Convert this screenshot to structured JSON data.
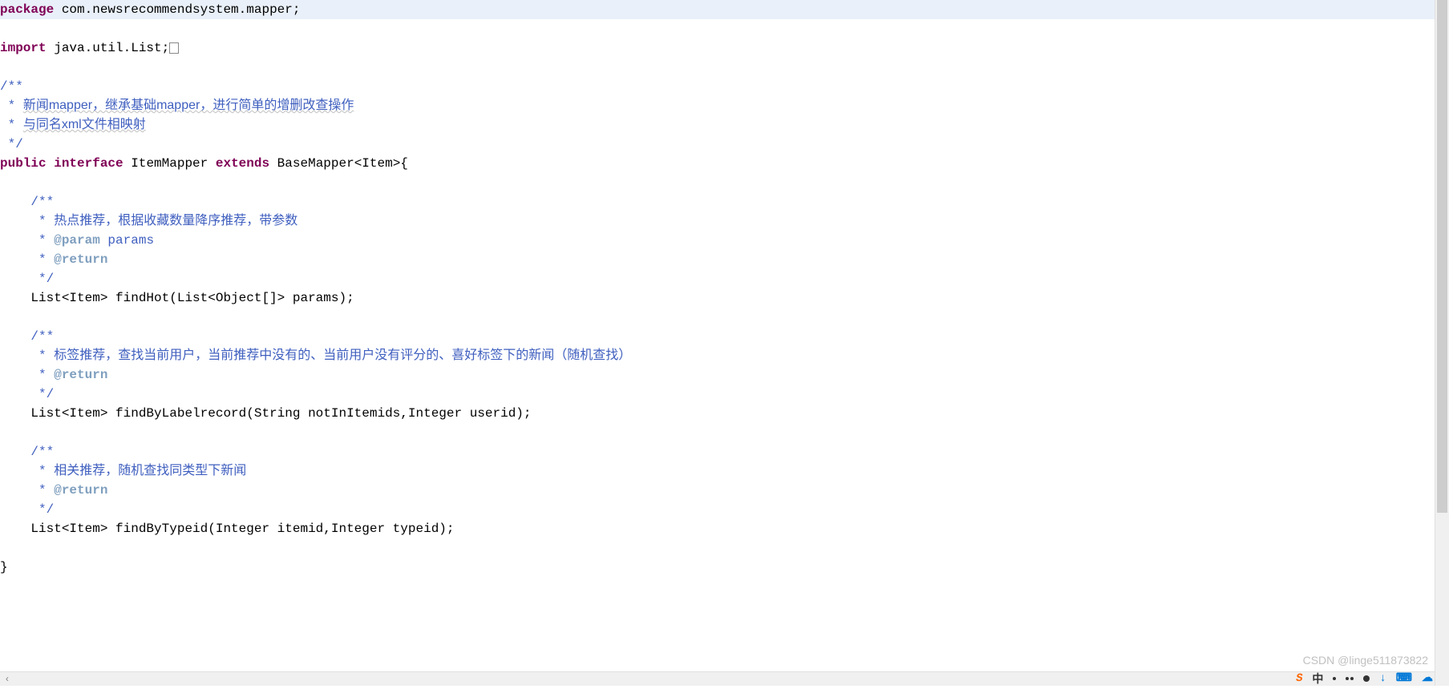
{
  "code": {
    "package_kw": "package",
    "package_name": " com.newsrecommendsystem.mapper;",
    "import_kw": "import",
    "import_name": " java.util.List;",
    "classdoc_open": "/**",
    "classdoc_l1_star": " * ",
    "classdoc_l1_text": "新闻mapper，继承基础mapper，进行简单的增删改查操作",
    "classdoc_l2_star": " * ",
    "classdoc_l2_text": "与同名xml文件相映射",
    "classdoc_close": " */",
    "public_kw": "public",
    "interface_kw": "interface",
    "class_mid": " ItemMapper ",
    "extends_kw": "extends",
    "class_tail": " BaseMapper<Item>{",
    "m1_doc_open": "    /**",
    "m1_doc_l1_star": "     * ",
    "m1_doc_l1_text": "热点推荐，根据收藏数量降序推荐，带参数",
    "m1_doc_l2_star": "     * ",
    "m1_doc_l2_tag": "@param",
    "m1_doc_l2_text": " params",
    "m1_doc_l3_star": "     * ",
    "m1_doc_l3_tag": "@return",
    "m1_doc_close": "     */",
    "m1_sig": "    List<Item> findHot(List<Object[]> params);",
    "m2_doc_open": "    /**",
    "m2_doc_l1_star": "     * ",
    "m2_doc_l1_text": "标签推荐，查找当前用户，当前推荐中没有的、当前用户没有评分的、喜好标签下的新闻（随机查找）",
    "m2_doc_l2_star": "     * ",
    "m2_doc_l2_tag": "@return",
    "m2_doc_close": "     */",
    "m2_sig": "    List<Item> findByLabelrecord(String notInItemids,Integer userid);",
    "m3_doc_open": "    /**",
    "m3_doc_l1_star": "     * ",
    "m3_doc_l1_text": "相关推荐，随机查找同类型下新闻",
    "m3_doc_l2_star": "     * ",
    "m3_doc_l2_tag": "@return",
    "m3_doc_close": "     */",
    "m3_sig": "    List<Item> findByTypeid(Integer itemid,Integer typeid);",
    "class_close": "}"
  },
  "watermark": "CSDN @linge511873822",
  "tray": {
    "s": "S",
    "zh": "中",
    "down": "↓",
    "kbd": "⌨",
    "cloud": "☁"
  }
}
